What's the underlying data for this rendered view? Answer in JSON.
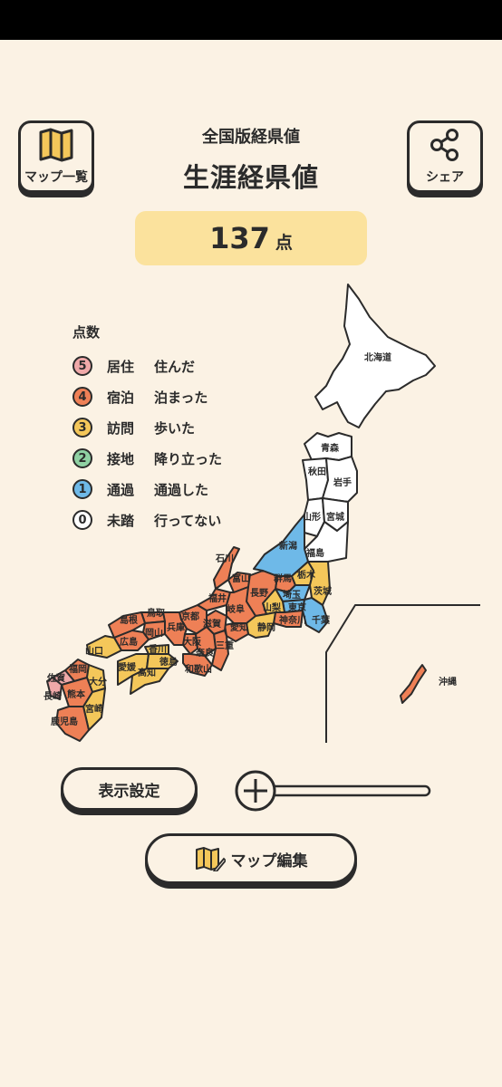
{
  "header": {
    "subtitle": "全国版経県値",
    "title": "生涯経県値",
    "map_list_label": "マップ一覧",
    "share_label": "シェア"
  },
  "score": {
    "value": "137",
    "unit": "点"
  },
  "legend": {
    "title": "点数",
    "items": [
      {
        "score": "5",
        "name": "居住",
        "desc": "住んだ",
        "color": "#f0a9a9"
      },
      {
        "score": "4",
        "name": "宿泊",
        "desc": "泊まった",
        "color": "#ee8056"
      },
      {
        "score": "3",
        "name": "訪問",
        "desc": "歩いた",
        "color": "#f4c75a"
      },
      {
        "score": "2",
        "name": "接地",
        "desc": "降り立った",
        "color": "#8fd1a3"
      },
      {
        "score": "1",
        "name": "通過",
        "desc": "通過した",
        "color": "#6eb9e8"
      },
      {
        "score": "0",
        "name": "未踏",
        "desc": "行ってない",
        "color": "#ffffff"
      }
    ]
  },
  "map": {
    "labels": {
      "hokkaido": "北海道",
      "aomori": "青森",
      "akita": "秋田",
      "iwate": "岩手",
      "yamagata": "山形",
      "miyagi": "宮城",
      "niigata": "新潟",
      "fukushima": "福島",
      "ishikawa": "石川",
      "toyama": "富山",
      "gunma": "群馬",
      "tochigi": "栃木",
      "ibaraki": "茨城",
      "fukui": "福井",
      "nagano": "長野",
      "saitama": "埼玉",
      "tokyo": "東京",
      "chiba": "千葉",
      "yamanashi": "山梨",
      "kanagawa": "神奈川",
      "gifu": "岐阜",
      "shizuoka": "静岡",
      "aichi": "愛知",
      "shiga": "滋賀",
      "kyoto": "京都",
      "mie": "三重",
      "osaka": "大阪",
      "nara": "奈良",
      "wakayama": "和歌山",
      "hyogo": "兵庫",
      "tottori": "鳥取",
      "shimane": "島根",
      "okayama": "岡山",
      "hiroshima": "広島",
      "yamaguchi": "山口",
      "kagawa": "香川",
      "tokushima": "徳島",
      "ehime": "愛媛",
      "kochi": "高知",
      "fukuoka": "福岡",
      "saga": "佐賀",
      "nagasaki": "長崎",
      "oita": "大分",
      "kumamoto": "熊本",
      "miyazaki": "宮崎",
      "kagoshima": "鹿児島",
      "okinawa": "沖縄"
    }
  },
  "controls": {
    "display_settings_label": "表示設定",
    "map_edit_label": "マップ編集",
    "zoom_level": 0
  }
}
